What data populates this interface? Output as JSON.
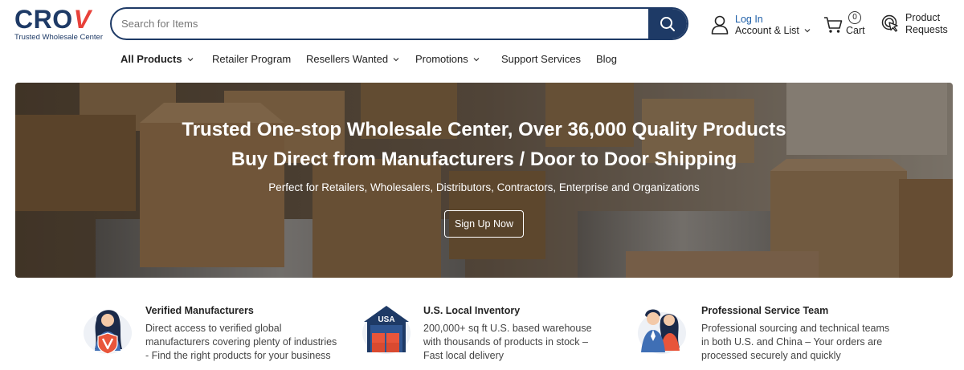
{
  "logo": {
    "word": "CRO",
    "v": "V",
    "tagline": "Trusted Wholesale Center"
  },
  "search": {
    "placeholder": "Search for Items"
  },
  "account": {
    "login": "Log In",
    "account_list": "Account & List"
  },
  "cart": {
    "count": "0",
    "label": "Cart"
  },
  "product_requests": {
    "line1": "Product",
    "line2": "Requests"
  },
  "nav": {
    "items": [
      {
        "label": "All Products"
      },
      {
        "label": "Retailer Program"
      },
      {
        "label": "Resellers Wanted"
      },
      {
        "label": "Promotions"
      },
      {
        "label": "Support Services"
      },
      {
        "label": "Blog"
      }
    ]
  },
  "hero": {
    "title1": "Trusted One-stop Wholesale Center, Over 36,000 Quality Products",
    "title2": "Buy Direct from Manufacturers / Door to Door Shipping",
    "subtitle": "Perfect for Retailers, Wholesalers, Distributors, Contractors, Enterprise and Organizations",
    "button": "Sign Up Now"
  },
  "features": [
    {
      "title": "Verified Manufacturers",
      "desc": "Direct access to verified global manufacturers covering plenty of industries - Find the right products for your business"
    },
    {
      "title": "U.S. Local Inventory",
      "desc": "200,000+ sq ft U.S. based warehouse with thousands of products in stock – Fast local delivery",
      "icon_text": "USA"
    },
    {
      "title": "Professional Service Team",
      "desc": "Professional sourcing and technical teams in both U.S. and China – Your orders are processed securely and quickly"
    }
  ],
  "colors": {
    "brand": "#1e3a66",
    "accent": "#e8413a",
    "link": "#1e5fa8"
  }
}
